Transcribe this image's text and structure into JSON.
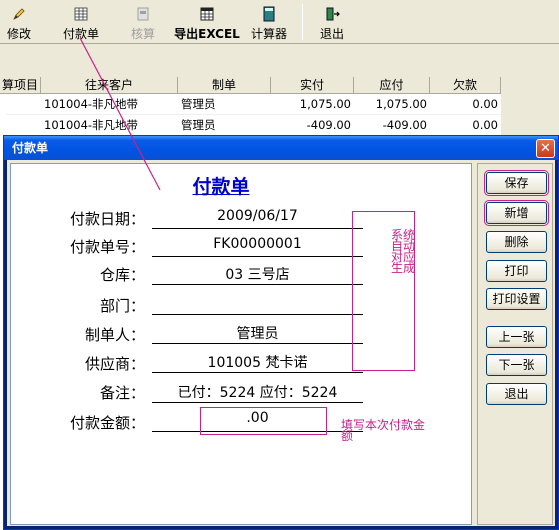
{
  "toolbar": {
    "buttons": [
      {
        "label": "修改",
        "icon": "pencil-icon"
      },
      {
        "label": "付款单",
        "icon": "grid-icon"
      },
      {
        "label": "核算",
        "icon": "calc-doc-icon"
      },
      {
        "label": "导出EXCEL",
        "icon": "table-icon"
      },
      {
        "label": "计算器",
        "icon": "calculator-icon"
      },
      {
        "label": "退出",
        "icon": "exit-door-icon"
      }
    ]
  },
  "table": {
    "headers": [
      "算项目",
      "往来客户",
      "制单",
      "实付",
      "应付",
      "欠款"
    ],
    "rows": [
      [
        "",
        "101004-非凡地带",
        "管理员",
        "1,075.00",
        "1,075.00",
        "0.00"
      ],
      [
        "",
        "101004-非凡地带",
        "管理员",
        "-409.00",
        "-409.00",
        "0.00"
      ]
    ]
  },
  "dialog": {
    "title": "付款单",
    "form_title": "付款单",
    "fields": [
      {
        "label": "付款日期：",
        "value": "2009/06/17"
      },
      {
        "label": "付款单号：",
        "value": "FK00000001"
      },
      {
        "label": "仓库：",
        "value": "03 三号店"
      },
      {
        "label": "部门：",
        "value": ""
      },
      {
        "label": "制单人：",
        "value": "管理员"
      },
      {
        "label": "供应商：",
        "value": "101005 梵卡诺"
      },
      {
        "label": "备注：",
        "value": "已付：5224 应付：5224"
      },
      {
        "label": "付款金额：",
        "value": ".00"
      }
    ],
    "annotations": {
      "auto": "系统自动对应生成",
      "amount": "填写本次付款金额"
    },
    "buttons": [
      "保存",
      "新增",
      "删除",
      "打印",
      "打印设置",
      "上一张",
      "下一张",
      "退出"
    ]
  },
  "colors": {
    "annotation": "#c8208e",
    "title_blue": "#0000cc",
    "titlebar": "#0054e3"
  }
}
